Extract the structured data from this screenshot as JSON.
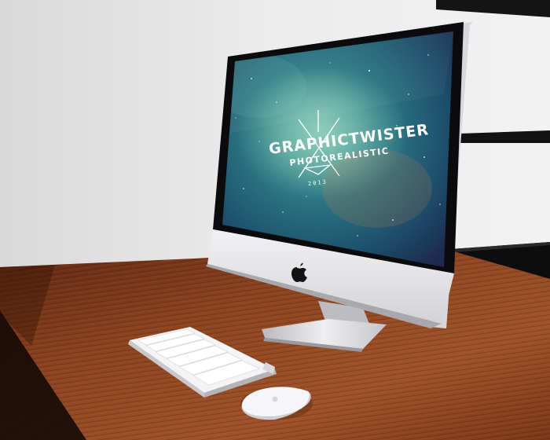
{
  "scene": {
    "description_items": [
      "wall",
      "shelves",
      "desk",
      "imac",
      "keyboard",
      "mouse"
    ]
  },
  "screen": {
    "wallpaper": {
      "title": "GRAPHICTWISTER",
      "subtitle": "PHOTOREALISTIC",
      "year": "2013"
    }
  },
  "colors": {
    "wall": "#e9e9ea",
    "desk_wood": "#7a3a1c",
    "imac_silver": "#e6e6e8",
    "screen_teal": "#2f7f86",
    "shelf_black": "#111111"
  }
}
